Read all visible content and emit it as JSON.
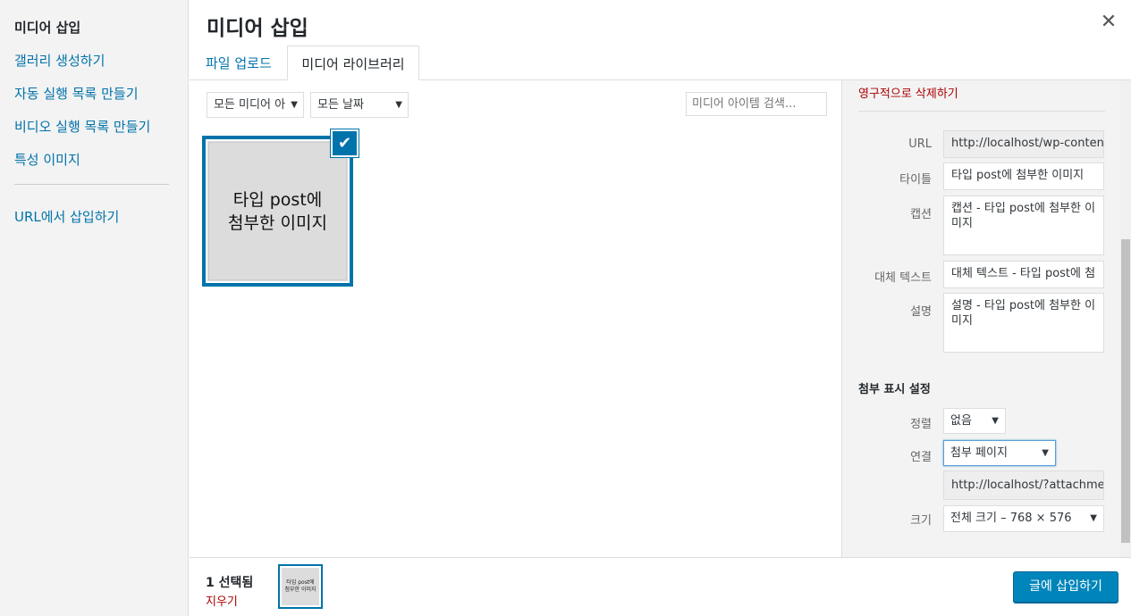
{
  "menu": {
    "items": [
      {
        "label": "미디어 삽입",
        "active": true
      },
      {
        "label": "갤러리 생성하기"
      },
      {
        "label": "자동 실행 목록 만들기"
      },
      {
        "label": "비디오 실행 목록 만들기"
      },
      {
        "label": "특성 이미지"
      },
      {
        "label": "URL에서 삽입하기"
      }
    ]
  },
  "header": {
    "title": "미디어 삽입",
    "close_icon": "✕"
  },
  "tabs": [
    {
      "label": "파일 업로드",
      "active": false
    },
    {
      "label": "미디어 라이브러리",
      "active": true
    }
  ],
  "toolbar": {
    "filter_type": "모든 미디어 아",
    "filter_date": "모든 날짜",
    "search_placeholder": "미디어 아이템 검색..."
  },
  "attachment": {
    "title_line1": "타입 post에",
    "title_line2": "첨부한 이미지",
    "check_icon": "✔"
  },
  "details": {
    "delete_label": "영구적으로 삭제하기",
    "url_label": "URL",
    "url_value": "http://localhost/wp-content",
    "title_label": "타이틀",
    "title_value": "타입 post에 첨부한 이미지",
    "caption_label": "캡션",
    "caption_value": "캡션 - 타입 post에 첨부한 이미지",
    "alt_label": "대체 텍스트",
    "alt_value": "대체 텍스트 - 타입 post에 첨",
    "desc_label": "설명",
    "desc_value": "설명 - 타입 post에 첨부한 이미지"
  },
  "display_settings": {
    "heading": "첨부 표시 설정",
    "align_label": "정렬",
    "align_value": "없음",
    "link_label": "연결",
    "link_value": "첨부 페이지",
    "link_url": "http://localhost/?attachmen",
    "size_label": "크기",
    "size_value": "전체 크기 – 768 × 576"
  },
  "footer": {
    "selected_count": "1 선택됨",
    "clear_label": "지우기",
    "thumb_line1": "타입 post에",
    "thumb_line2": "첨부한 이미지",
    "insert_label": "글에 삽입하기"
  },
  "colors": {
    "accent": "#0073aa",
    "button": "#0085ba",
    "danger": "#a00"
  }
}
